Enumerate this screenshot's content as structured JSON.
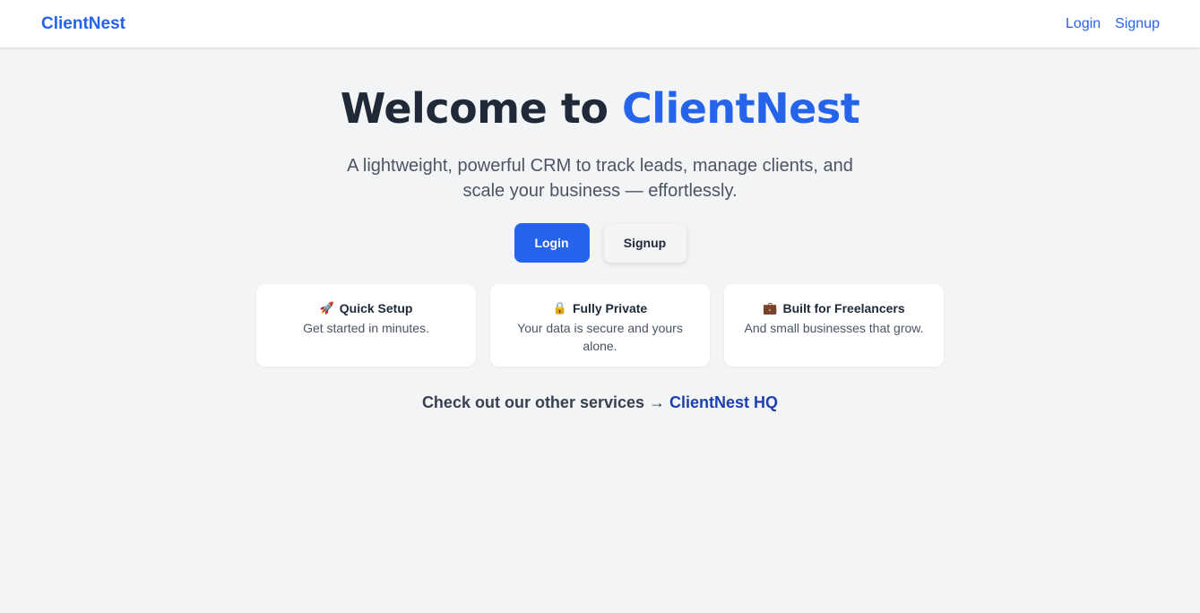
{
  "nav": {
    "brand": "ClientNest",
    "login": "Login",
    "signup": "Signup"
  },
  "hero": {
    "headline_prefix": "Welcome to ",
    "headline_accent": "ClientNest",
    "tagline": "A lightweight, powerful CRM to track leads, manage clients, and scale your business — effortlessly.",
    "login_button": "Login",
    "signup_button": "Signup"
  },
  "features": [
    {
      "icon": "🚀",
      "icon_name": "rocket-icon",
      "title": "Quick Setup",
      "description": "Get started in minutes."
    },
    {
      "icon": "🔒",
      "icon_name": "lock-icon",
      "title": "Fully Private",
      "description": "Your data is secure and yours alone."
    },
    {
      "icon": "💼",
      "icon_name": "briefcase-icon",
      "title": "Built for Freelancers",
      "description": "And small businesses that grow."
    }
  ],
  "services": {
    "prefix": "Check out our other services → ",
    "link": "ClientNest HQ"
  },
  "colors": {
    "accent": "#2563eb",
    "background": "#f3f4f6",
    "link_dark": "#1e40af"
  }
}
